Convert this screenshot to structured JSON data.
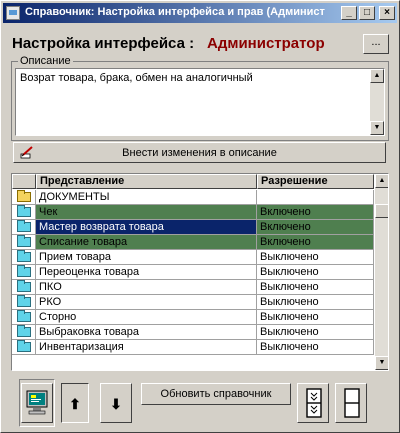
{
  "window": {
    "title": "Справочник: Настройка интерфейса и прав (Админист",
    "min_glyph": "_",
    "max_glyph": "□",
    "close_glyph": "×"
  },
  "header": {
    "label": "Настройка интерфейса :",
    "user": "Администратор",
    "dots_button": "..."
  },
  "description": {
    "legend": "Описание",
    "text": "Возрат товара, брака, обмен на аналогичный"
  },
  "apply_button": "Внести изменения в описание",
  "grid": {
    "columns": [
      "Представление",
      "Разрешение"
    ],
    "rows": [
      {
        "name": "ДОКУМЕНТЫ",
        "permission": "",
        "icon": "folder-yellow",
        "state": "normal"
      },
      {
        "name": "Чек",
        "permission": "Включено",
        "icon": "folder-cyan",
        "state": "green"
      },
      {
        "name": "Мастер возврата товара",
        "permission": "Включено",
        "icon": "folder-cyan",
        "state": "selected"
      },
      {
        "name": "Списание товара",
        "permission": "Включено",
        "icon": "folder-cyan",
        "state": "green"
      },
      {
        "name": "Прием товара",
        "permission": "Выключено",
        "icon": "folder-cyan",
        "state": "normal"
      },
      {
        "name": "Переоценка товара",
        "permission": "Выключено",
        "icon": "folder-cyan",
        "state": "normal"
      },
      {
        "name": "ПКО",
        "permission": "Выключено",
        "icon": "folder-cyan",
        "state": "normal"
      },
      {
        "name": "РКО",
        "permission": "Выключено",
        "icon": "folder-cyan",
        "state": "normal"
      },
      {
        "name": "Сторно",
        "permission": "Выключено",
        "icon": "folder-cyan",
        "state": "normal"
      },
      {
        "name": "Выбраковка товара",
        "permission": "Выключено",
        "icon": "folder-cyan",
        "state": "normal"
      },
      {
        "name": "Инвентаризация",
        "permission": "Выключено",
        "icon": "folder-cyan",
        "state": "normal"
      }
    ]
  },
  "toolbar": {
    "refresh_label": "Обновить справочник",
    "up_glyph": "⬆",
    "down_glyph": "⬇"
  },
  "colors": {
    "allowed_row": "#4f7f4f",
    "selected_row": "#0a246a",
    "accent_user": "#8b0000"
  }
}
